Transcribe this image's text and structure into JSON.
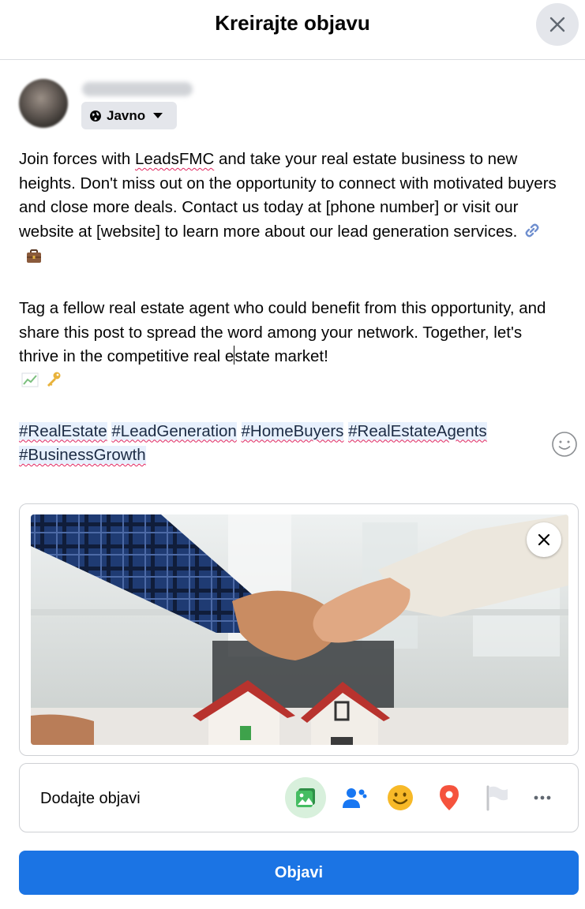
{
  "dialog": {
    "title": "Kreirajte objavu"
  },
  "author": {
    "privacy_label": "Javno"
  },
  "post": {
    "p1": {
      "t1": "Join forces with ",
      "t2": "LeadsFMC",
      "t3": " and take your real estate business to new heights. Don't miss out on the opportunity to connect with motivated buyers and close more deals. Contact us today at [phone number] or visit our website at [website] to learn more about our lead generation services. "
    },
    "p2": {
      "t1": "Tag a fellow real estate agent who could benefit from this opportunity, and share this post to spread the word among your network. Together, let's thrive in the competitive real e",
      "t2": "state market!"
    },
    "hashtags": [
      "#RealEstate",
      "#LeadGeneration",
      "#HomeBuyers",
      "#RealEstateAgents",
      "#BusinessGrowth"
    ],
    "emojis": [
      "link-emoji",
      "briefcase-emoji",
      "chart-increasing-emoji",
      "key-emoji"
    ]
  },
  "add_to_post": {
    "label": "Dodajte objavi",
    "icons": [
      "photo-video-icon",
      "tag-people-icon",
      "feeling-icon",
      "location-icon",
      "flag-icon",
      "more-icon"
    ]
  },
  "publish_button": "Objavi",
  "colors": {
    "primary": "#1b74e4",
    "hashtag_bg": "#e7f0fd",
    "photo_icon": "#45bd62",
    "tag_icon": "#1877f2",
    "feeling_icon": "#f7b928",
    "location_icon": "#f5533d",
    "button_bg": "#e4e6eb"
  }
}
